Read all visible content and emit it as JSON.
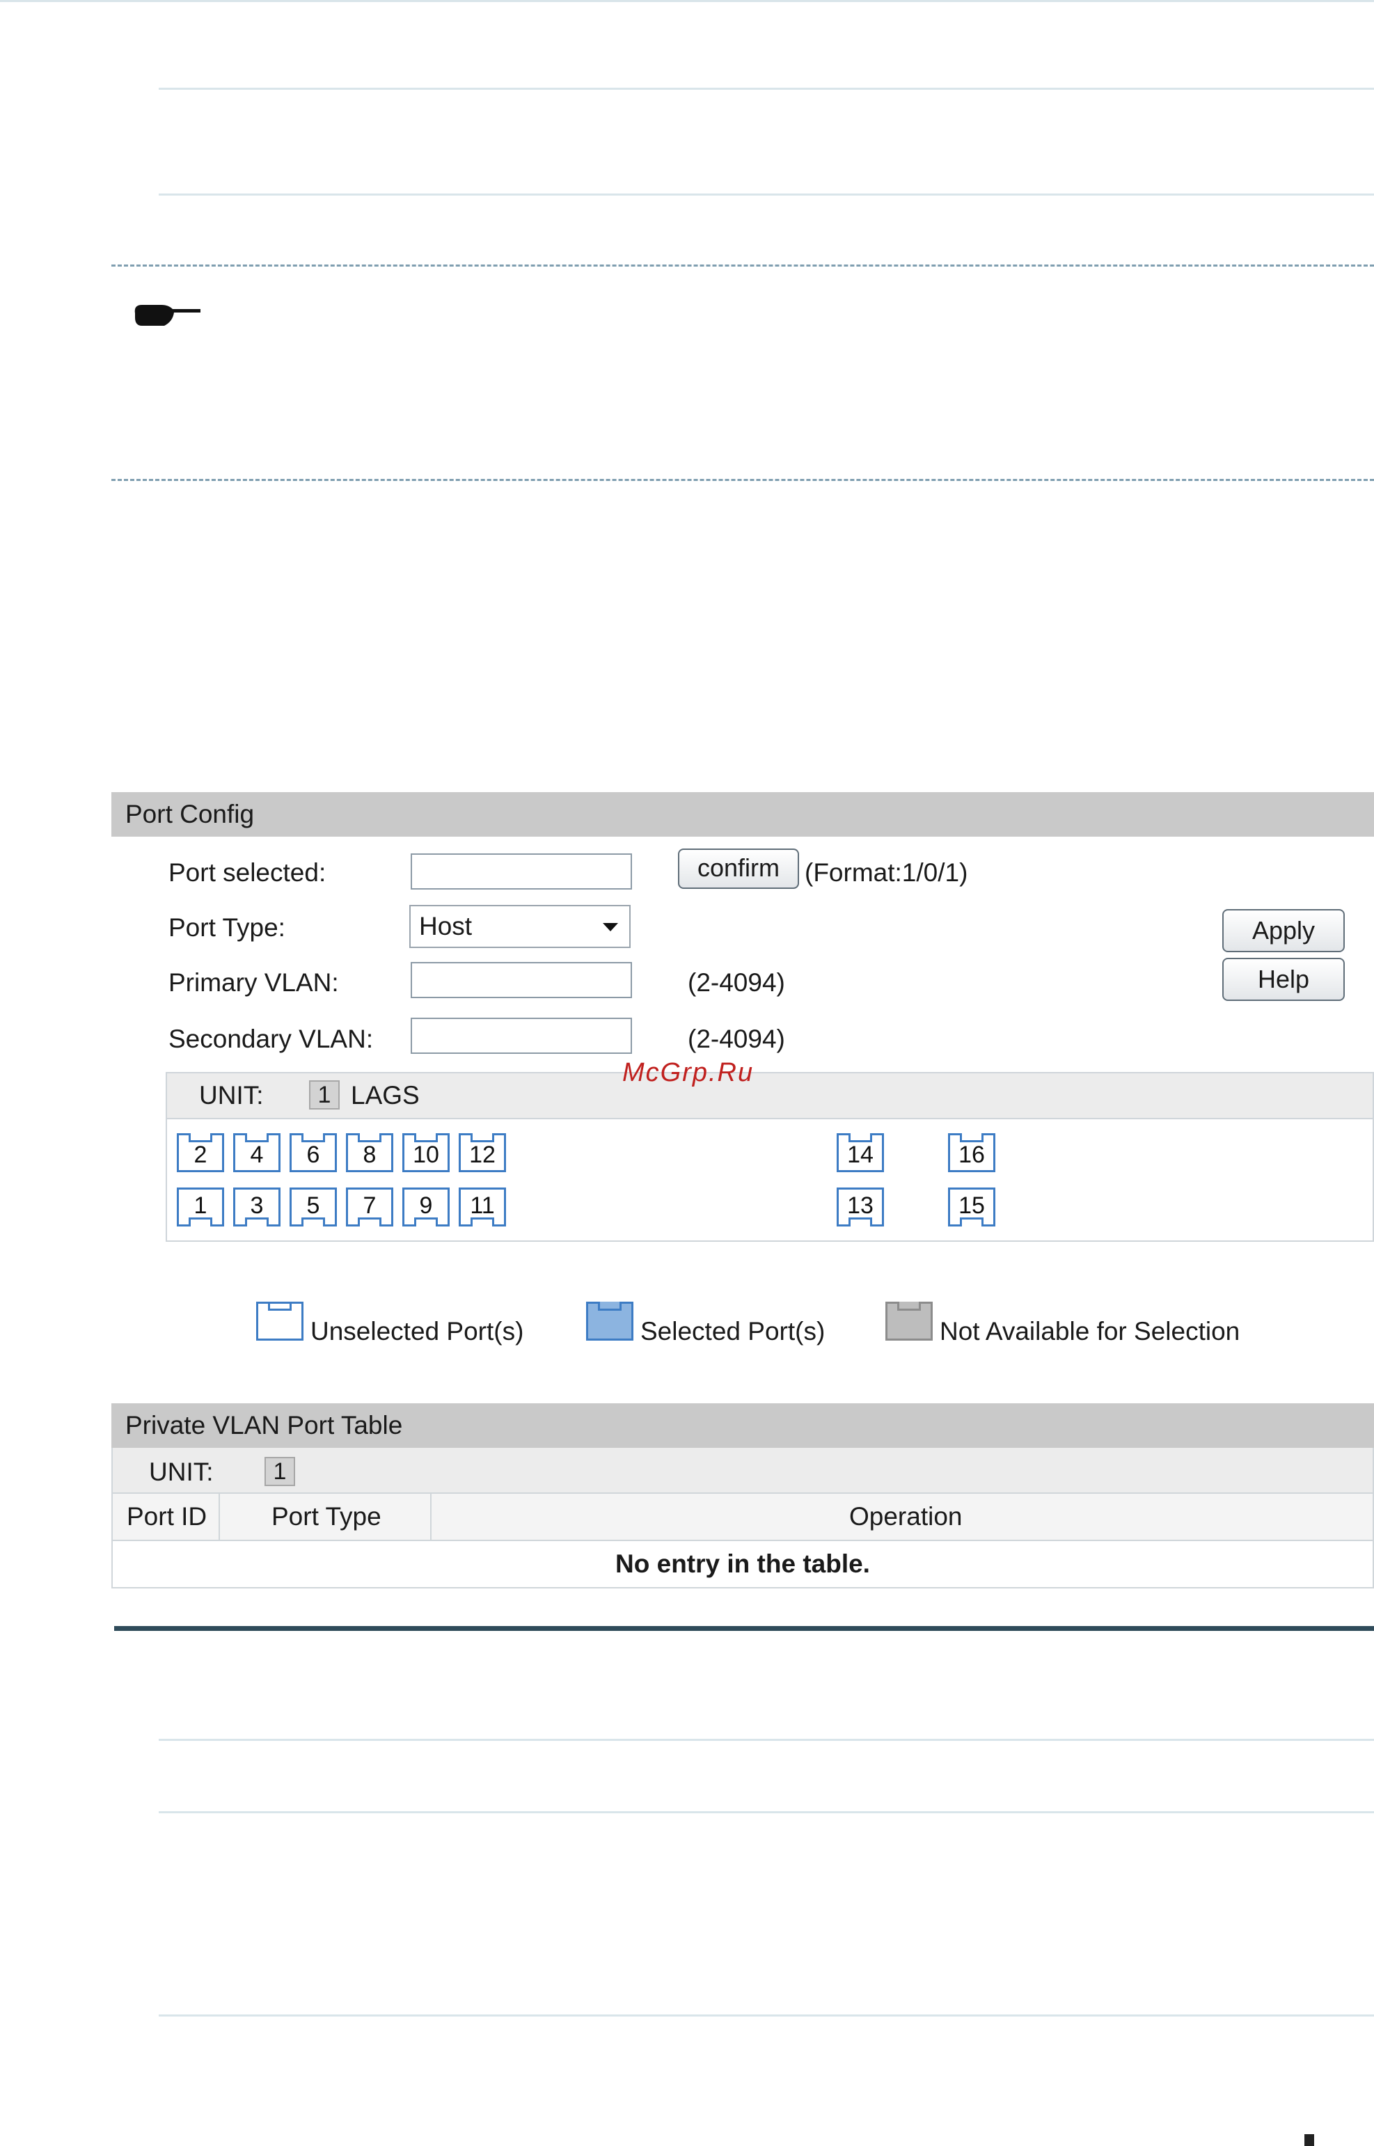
{
  "watermark": "McGrp.Ru",
  "port_config": {
    "title": "Port Config",
    "port_selected_label": "Port selected:",
    "port_selected_value": "",
    "confirm_label": "confirm",
    "format_hint": "(Format:1/0/1)",
    "port_type_label": "Port Type:",
    "port_type_value": "Host",
    "primary_vlan_label": "Primary VLAN:",
    "primary_vlan_value": "",
    "primary_vlan_range": "(2-4094)",
    "secondary_vlan_label": "Secondary VLAN:",
    "secondary_vlan_value": "",
    "secondary_vlan_range": "(2-4094)",
    "apply_label": "Apply",
    "help_label": "Help",
    "unit_label": "UNIT:",
    "unit_value": "1",
    "lags_label": "LAGS",
    "ports_top": [
      "2",
      "4",
      "6",
      "8",
      "10",
      "12",
      "14",
      "16"
    ],
    "ports_bottom": [
      "1",
      "3",
      "5",
      "7",
      "9",
      "11",
      "13",
      "15"
    ]
  },
  "legend": {
    "unselected": "Unselected Port(s)",
    "selected": "Selected Port(s)",
    "not_available": "Not Available for Selection"
  },
  "port_table": {
    "title": "Private VLAN Port Table",
    "unit_label": "UNIT:",
    "unit_value": "1",
    "columns": [
      "Port ID",
      "Port Type",
      "Operation"
    ],
    "empty_message": "No entry in the table."
  },
  "colors": {
    "port_border": "#3d7cc4",
    "selected_fill": "#8cb4e0",
    "unavailable_fill": "#bdbdbd",
    "section_bar": "#c9c9c9"
  }
}
